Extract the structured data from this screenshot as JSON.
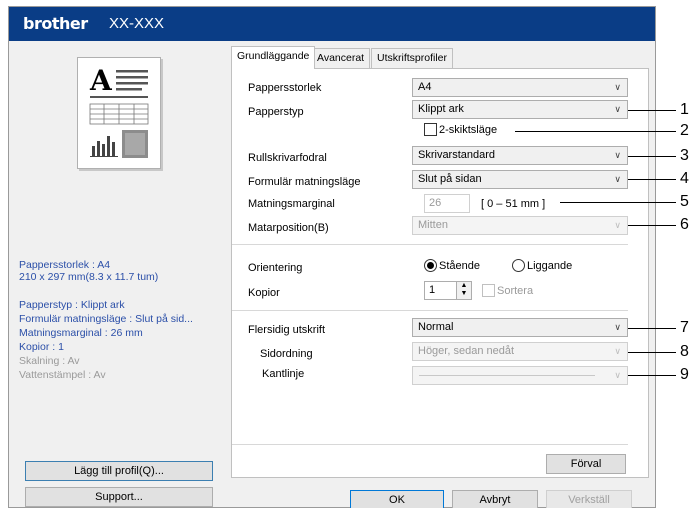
{
  "window": {
    "brand": "brother",
    "model": "XX-XXX"
  },
  "summary": {
    "paper_size": "Pappersstorlek : A4",
    "paper_dims": "210 x 297 mm(8.3 x 11.7 tum)",
    "paper_type": "Papperstyp : Klippt ark",
    "feed_mode": "Formulär matningsläge : Slut på sid...",
    "feed_margin": "Matningsmarginal : 26 mm",
    "copies": "Kopior : 1",
    "scaling": "Skalning : Av",
    "watermark": "Vattenstämpel : Av"
  },
  "left_buttons": {
    "add_profile": "Lägg till profil(Q)...",
    "support": "Support..."
  },
  "tabs": [
    {
      "label": "Grundläggande"
    },
    {
      "label": "Avancerat"
    },
    {
      "label": "Utskriftsprofiler"
    }
  ],
  "form": {
    "paper_size": {
      "label": "Pappersstorlek",
      "value": "A4"
    },
    "paper_type": {
      "label": "Papperstyp",
      "value": "Klippt ark"
    },
    "two_layer": {
      "label": "2-skiktsläge",
      "checked": false
    },
    "roll_holder": {
      "label": "Rullskrivarfodral",
      "value": "Skrivarstandard"
    },
    "feed_mode": {
      "label": "Formulär matningsläge",
      "value": "Slut på sidan"
    },
    "feed_margin": {
      "label": "Matningsmarginal",
      "value": "26",
      "range": "[ 0 – 51 mm ]"
    },
    "feed_position": {
      "label": "Matarposition(B)",
      "value": "Mitten"
    },
    "orientation": {
      "label": "Orientering",
      "portrait": "Stående",
      "landscape": "Liggande",
      "selected": "portrait"
    },
    "copies": {
      "label": "Kopior",
      "value": "1",
      "collate": "Sortera"
    },
    "duplex": {
      "label": "Flersidig utskrift",
      "value": "Normal"
    },
    "page_order": {
      "label": "Sidordning",
      "value": "Höger, sedan nedåt"
    },
    "border": {
      "label": "Kantlinje",
      "value": ""
    },
    "defaults_button": "Förval"
  },
  "dialog_buttons": {
    "ok": "OK",
    "cancel": "Avbryt",
    "apply": "Verkställ"
  },
  "callouts": [
    "1",
    "2",
    "3",
    "4",
    "5",
    "6",
    "7",
    "8",
    "9"
  ]
}
